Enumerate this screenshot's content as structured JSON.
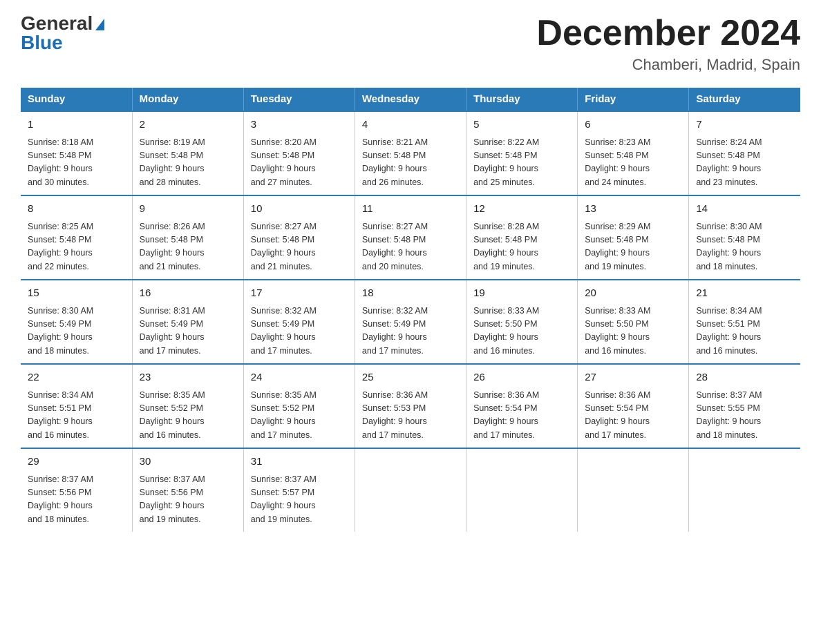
{
  "logo": {
    "general": "General",
    "blue": "Blue"
  },
  "header": {
    "title": "December 2024",
    "subtitle": "Chamberi, Madrid, Spain"
  },
  "weekdays": [
    "Sunday",
    "Monday",
    "Tuesday",
    "Wednesday",
    "Thursday",
    "Friday",
    "Saturday"
  ],
  "weeks": [
    [
      {
        "day": "1",
        "sunrise": "8:18 AM",
        "sunset": "5:48 PM",
        "daylight": "9 hours and 30 minutes."
      },
      {
        "day": "2",
        "sunrise": "8:19 AM",
        "sunset": "5:48 PM",
        "daylight": "9 hours and 28 minutes."
      },
      {
        "day": "3",
        "sunrise": "8:20 AM",
        "sunset": "5:48 PM",
        "daylight": "9 hours and 27 minutes."
      },
      {
        "day": "4",
        "sunrise": "8:21 AM",
        "sunset": "5:48 PM",
        "daylight": "9 hours and 26 minutes."
      },
      {
        "day": "5",
        "sunrise": "8:22 AM",
        "sunset": "5:48 PM",
        "daylight": "9 hours and 25 minutes."
      },
      {
        "day": "6",
        "sunrise": "8:23 AM",
        "sunset": "5:48 PM",
        "daylight": "9 hours and 24 minutes."
      },
      {
        "day": "7",
        "sunrise": "8:24 AM",
        "sunset": "5:48 PM",
        "daylight": "9 hours and 23 minutes."
      }
    ],
    [
      {
        "day": "8",
        "sunrise": "8:25 AM",
        "sunset": "5:48 PM",
        "daylight": "9 hours and 22 minutes."
      },
      {
        "day": "9",
        "sunrise": "8:26 AM",
        "sunset": "5:48 PM",
        "daylight": "9 hours and 21 minutes."
      },
      {
        "day": "10",
        "sunrise": "8:27 AM",
        "sunset": "5:48 PM",
        "daylight": "9 hours and 21 minutes."
      },
      {
        "day": "11",
        "sunrise": "8:27 AM",
        "sunset": "5:48 PM",
        "daylight": "9 hours and 20 minutes."
      },
      {
        "day": "12",
        "sunrise": "8:28 AM",
        "sunset": "5:48 PM",
        "daylight": "9 hours and 19 minutes."
      },
      {
        "day": "13",
        "sunrise": "8:29 AM",
        "sunset": "5:48 PM",
        "daylight": "9 hours and 19 minutes."
      },
      {
        "day": "14",
        "sunrise": "8:30 AM",
        "sunset": "5:48 PM",
        "daylight": "9 hours and 18 minutes."
      }
    ],
    [
      {
        "day": "15",
        "sunrise": "8:30 AM",
        "sunset": "5:49 PM",
        "daylight": "9 hours and 18 minutes."
      },
      {
        "day": "16",
        "sunrise": "8:31 AM",
        "sunset": "5:49 PM",
        "daylight": "9 hours and 17 minutes."
      },
      {
        "day": "17",
        "sunrise": "8:32 AM",
        "sunset": "5:49 PM",
        "daylight": "9 hours and 17 minutes."
      },
      {
        "day": "18",
        "sunrise": "8:32 AM",
        "sunset": "5:49 PM",
        "daylight": "9 hours and 17 minutes."
      },
      {
        "day": "19",
        "sunrise": "8:33 AM",
        "sunset": "5:50 PM",
        "daylight": "9 hours and 16 minutes."
      },
      {
        "day": "20",
        "sunrise": "8:33 AM",
        "sunset": "5:50 PM",
        "daylight": "9 hours and 16 minutes."
      },
      {
        "day": "21",
        "sunrise": "8:34 AM",
        "sunset": "5:51 PM",
        "daylight": "9 hours and 16 minutes."
      }
    ],
    [
      {
        "day": "22",
        "sunrise": "8:34 AM",
        "sunset": "5:51 PM",
        "daylight": "9 hours and 16 minutes."
      },
      {
        "day": "23",
        "sunrise": "8:35 AM",
        "sunset": "5:52 PM",
        "daylight": "9 hours and 16 minutes."
      },
      {
        "day": "24",
        "sunrise": "8:35 AM",
        "sunset": "5:52 PM",
        "daylight": "9 hours and 17 minutes."
      },
      {
        "day": "25",
        "sunrise": "8:36 AM",
        "sunset": "5:53 PM",
        "daylight": "9 hours and 17 minutes."
      },
      {
        "day": "26",
        "sunrise": "8:36 AM",
        "sunset": "5:54 PM",
        "daylight": "9 hours and 17 minutes."
      },
      {
        "day": "27",
        "sunrise": "8:36 AM",
        "sunset": "5:54 PM",
        "daylight": "9 hours and 17 minutes."
      },
      {
        "day": "28",
        "sunrise": "8:37 AM",
        "sunset": "5:55 PM",
        "daylight": "9 hours and 18 minutes."
      }
    ],
    [
      {
        "day": "29",
        "sunrise": "8:37 AM",
        "sunset": "5:56 PM",
        "daylight": "9 hours and 18 minutes."
      },
      {
        "day": "30",
        "sunrise": "8:37 AM",
        "sunset": "5:56 PM",
        "daylight": "9 hours and 19 minutes."
      },
      {
        "day": "31",
        "sunrise": "8:37 AM",
        "sunset": "5:57 PM",
        "daylight": "9 hours and 19 minutes."
      },
      null,
      null,
      null,
      null
    ]
  ],
  "labels": {
    "sunrise": "Sunrise:",
    "sunset": "Sunset:",
    "daylight": "Daylight:"
  }
}
